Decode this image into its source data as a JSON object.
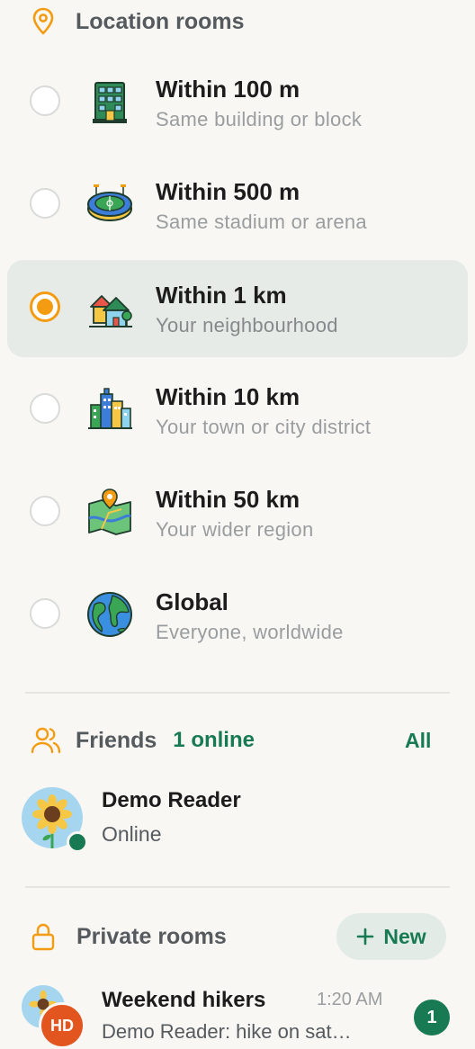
{
  "location_section": {
    "title": "Location rooms",
    "icon": "map-pin-icon",
    "rooms": [
      {
        "title": "Within 100 m",
        "subtitle": "Same building or block",
        "icon": "building-icon",
        "selected": false
      },
      {
        "title": "Within 500 m",
        "subtitle": "Same stadium or arena",
        "icon": "stadium-icon",
        "selected": false
      },
      {
        "title": "Within 1 km",
        "subtitle": "Your neighbourhood",
        "icon": "neighbourhood-icon",
        "selected": true
      },
      {
        "title": "Within 10 km",
        "subtitle": "Your town or city district",
        "icon": "city-icon",
        "selected": false
      },
      {
        "title": "Within 50 km",
        "subtitle": "Your wider region",
        "icon": "map-icon",
        "selected": false
      },
      {
        "title": "Global",
        "subtitle": "Everyone, worldwide",
        "icon": "globe-icon",
        "selected": false
      }
    ]
  },
  "friends_section": {
    "title": "Friends",
    "online_count": "1 online",
    "all_label": "All",
    "friends": [
      {
        "name": "Demo Reader",
        "status": "Online",
        "avatar": "sunflower-avatar"
      }
    ]
  },
  "private_section": {
    "title": "Private rooms",
    "new_button": "New",
    "new_icon": "plus-icon",
    "rooms": [
      {
        "name": "Weekend hikers",
        "time": "1:20 AM",
        "preview": "Demo Reader: hike on sat…",
        "initials": "HD",
        "unread": "1"
      }
    ]
  },
  "colors": {
    "accent": "#f39c12",
    "green": "#177a52",
    "background": "#f8f7f3",
    "selected_bg": "#e7ebe7"
  }
}
